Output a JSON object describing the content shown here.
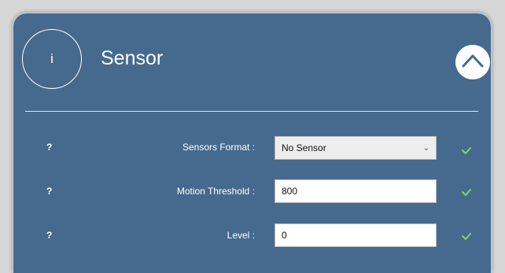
{
  "header": {
    "info_icon_glyph": "i",
    "title": "Sensor"
  },
  "rows": [
    {
      "help": "?",
      "label": "Sensors Format :",
      "value": "No Sensor",
      "type": "select",
      "status": "valid"
    },
    {
      "help": "?",
      "label": "Motion Threshold :",
      "value": "800",
      "type": "text",
      "status": "valid"
    },
    {
      "help": "?",
      "label": "Level :",
      "value": "0",
      "type": "text",
      "status": "valid"
    }
  ],
  "colors": {
    "panel_background": "#456a8e",
    "check_green": "#7ed957"
  }
}
